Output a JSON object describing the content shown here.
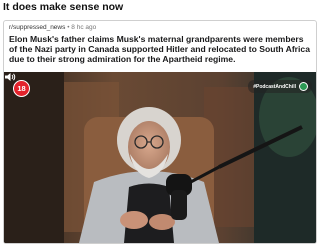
{
  "post": {
    "caption": "It does make sense now",
    "subreddit": "r/suppressed_news",
    "separator": "•",
    "time_ago": "8 hc ago",
    "headline": "Elon Musk's father claims Musk's maternal grandparents were members of the Nazi party in Canada supported Hitler and relocated to South Africa due to their strong admiration for the Apartheid regime."
  },
  "video": {
    "age_rating": "18",
    "podcast_tag": "#PodcastAndChill",
    "icons": {
      "volume": "speaker-icon"
    }
  },
  "colors": {
    "age_badge": "#e3232c",
    "podcast_dot": "#2c9a54",
    "background": "#3a2b22"
  }
}
